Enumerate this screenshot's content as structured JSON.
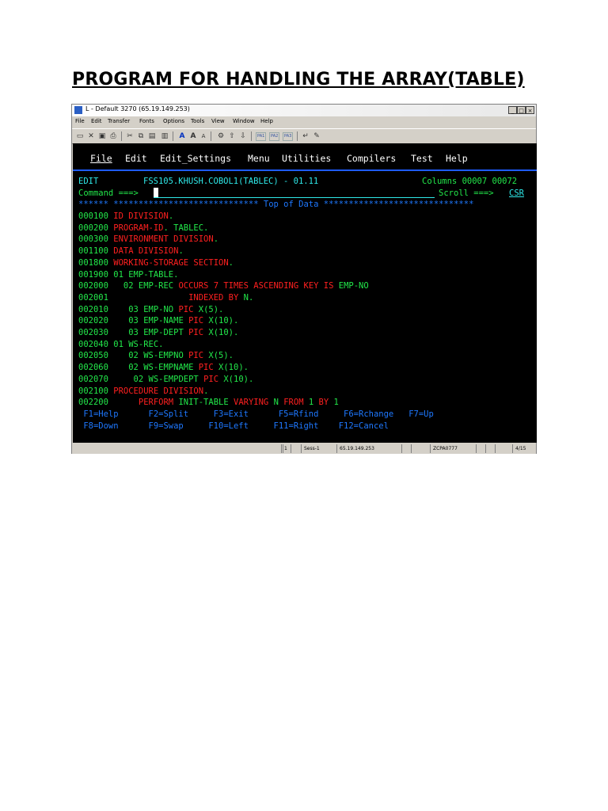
{
  "document": {
    "title": "PROGRAM FOR HANDLING THE ARRAY(TABLE)"
  },
  "window": {
    "title": "L - Default 3270 (65.19.149.253)",
    "controls": [
      "_",
      "□",
      "×"
    ],
    "menu": [
      "File",
      "Edit",
      "Transfer",
      "Fonts",
      "Options",
      "Tools",
      "View",
      "Window",
      "Help"
    ],
    "toolbar_pa": [
      "PA1",
      "PA2",
      "PA3"
    ]
  },
  "ispf": {
    "menu": [
      "File",
      "Edit",
      "Edit_Settings",
      "Menu",
      "Utilities",
      "Compilers",
      "Test",
      "Help"
    ],
    "mode": "EDIT",
    "dataset": "FSS105.KHUSH.COBOL1(TABLEC) - 01.11",
    "columns_label": "Columns 00007 00072",
    "command_label": "Command ===>",
    "scroll_label": "Scroll ===>",
    "scroll_value": "CSR",
    "top_of_data": "****** ***************************** Top of Data ******************************",
    "lines": [
      {
        "num": "000100",
        "segs": [
          {
            "t": "ID DIVISION",
            "c": "red"
          },
          {
            "t": ".",
            "c": "green"
          }
        ]
      },
      {
        "num": "000200",
        "segs": [
          {
            "t": "PROGRAM-ID",
            "c": "red"
          },
          {
            "t": ". TABLEC.",
            "c": "green"
          }
        ]
      },
      {
        "num": "000300",
        "segs": [
          {
            "t": "ENVIRONMENT DIVISION",
            "c": "red"
          },
          {
            "t": ".",
            "c": "green"
          }
        ]
      },
      {
        "num": "001100",
        "segs": [
          {
            "t": "DATA DIVISION",
            "c": "red"
          },
          {
            "t": ".",
            "c": "green"
          }
        ]
      },
      {
        "num": "001800",
        "segs": [
          {
            "t": "WORKING-STORAGE SECTION",
            "c": "red"
          },
          {
            "t": ".",
            "c": "green"
          }
        ]
      },
      {
        "num": "001900",
        "segs": [
          {
            "t": "01 EMP-TABLE.",
            "c": "green"
          }
        ]
      },
      {
        "num": "002000",
        "segs": [
          {
            "t": "  02 EMP-REC ",
            "c": "green"
          },
          {
            "t": "OCCURS 7 TIMES ASCENDING KEY IS ",
            "c": "red"
          },
          {
            "t": "EMP-NO",
            "c": "green"
          }
        ]
      },
      {
        "num": "002001",
        "segs": [
          {
            "t": "               ",
            "c": "green"
          },
          {
            "t": "INDEXED BY ",
            "c": "red"
          },
          {
            "t": "N.",
            "c": "green"
          }
        ]
      },
      {
        "num": "002010",
        "segs": [
          {
            "t": "   03 EMP-NO ",
            "c": "green"
          },
          {
            "t": "PIC ",
            "c": "red"
          },
          {
            "t": "X(5).",
            "c": "green"
          }
        ]
      },
      {
        "num": "002020",
        "segs": [
          {
            "t": "   03 EMP-NAME ",
            "c": "green"
          },
          {
            "t": "PIC ",
            "c": "red"
          },
          {
            "t": "X(10).",
            "c": "green"
          }
        ]
      },
      {
        "num": "002030",
        "segs": [
          {
            "t": "   03 EMP-DEPT ",
            "c": "green"
          },
          {
            "t": "PIC ",
            "c": "red"
          },
          {
            "t": "X(10).",
            "c": "green"
          }
        ]
      },
      {
        "num": "002040",
        "segs": [
          {
            "t": "01 WS-REC.",
            "c": "green"
          }
        ]
      },
      {
        "num": "002050",
        "segs": [
          {
            "t": "   02 WS-EMPNO ",
            "c": "green"
          },
          {
            "t": "PIC ",
            "c": "red"
          },
          {
            "t": "X(5).",
            "c": "green"
          }
        ]
      },
      {
        "num": "002060",
        "segs": [
          {
            "t": "   02 WS-EMPNAME ",
            "c": "green"
          },
          {
            "t": "PIC ",
            "c": "red"
          },
          {
            "t": "X(10).",
            "c": "green"
          }
        ]
      },
      {
        "num": "002070",
        "segs": [
          {
            "t": "    02 WS-EMPDEPT ",
            "c": "green"
          },
          {
            "t": "PIC ",
            "c": "red"
          },
          {
            "t": "X(10).",
            "c": "green"
          }
        ]
      },
      {
        "num": "002100",
        "segs": [
          {
            "t": "PROCEDURE DIVISION",
            "c": "red"
          },
          {
            "t": ".",
            "c": "green"
          }
        ]
      },
      {
        "num": "002200",
        "segs": [
          {
            "t": "     PERFORM ",
            "c": "red"
          },
          {
            "t": "INIT-TABLE ",
            "c": "green"
          },
          {
            "t": "VARYING ",
            "c": "red"
          },
          {
            "t": "N ",
            "c": "green"
          },
          {
            "t": "FROM ",
            "c": "red"
          },
          {
            "t": "1 ",
            "c": "green"
          },
          {
            "t": "BY ",
            "c": "red"
          },
          {
            "t": "1",
            "c": "green"
          }
        ]
      }
    ],
    "fkeys_row1": " F1=Help      F2=Split     F3=Exit      F5=Rfind     F6=Rchange   F7=Up",
    "fkeys_row2": " F8=Down      F9=Swap     F10=Left     F11=Right    F12=Cancel"
  },
  "statusbar": [
    "1",
    "Sess-1",
    "65.19.149.253",
    "ZCPA0777",
    "4/15"
  ]
}
